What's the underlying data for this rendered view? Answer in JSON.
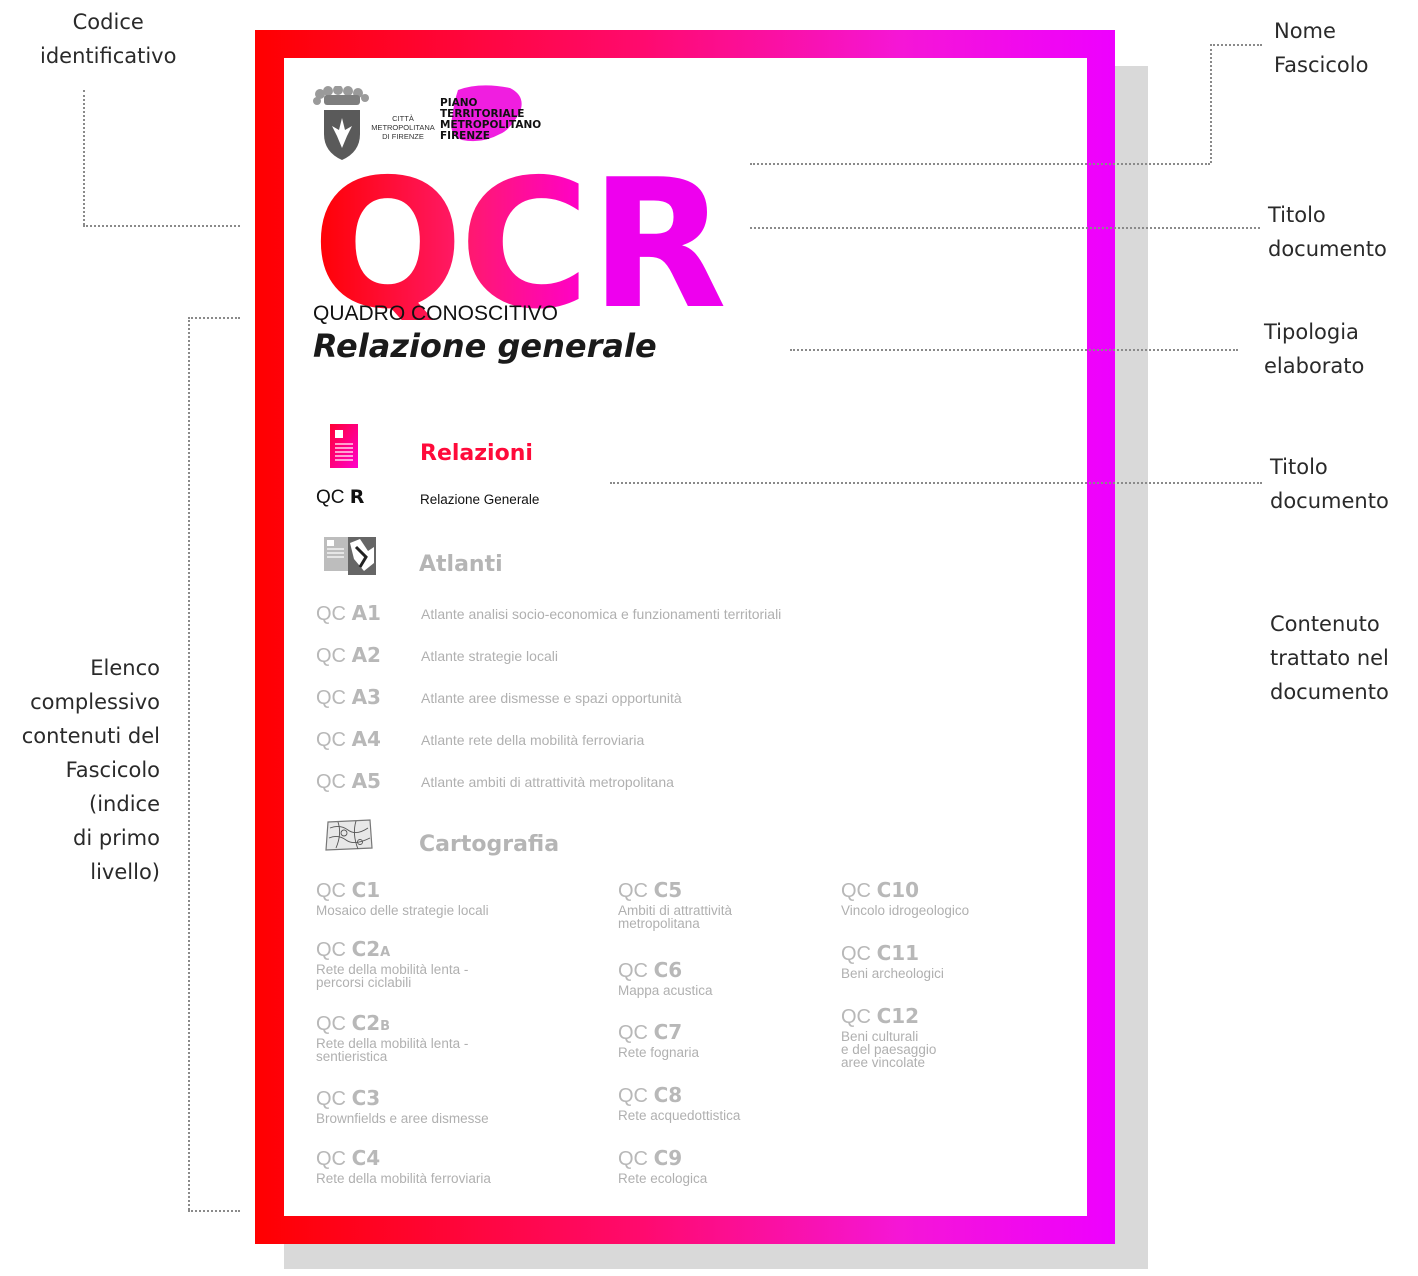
{
  "annotations": {
    "codice": "Codice\nidentificativo",
    "nome_fascicolo": "Nome\nFascicolo",
    "titolo_documento_1": "Titolo\ndocumento",
    "tipologia": "Tipologia\nelaborato",
    "titolo_documento_2": "Titolo\ndocumento",
    "contenuto": "Contenuto\ntrattato nel\ndocumento",
    "elenco": "Elenco\ncomplessivo\ncontenuti del\nFascicolo\n(indice\ndi primo\nlivello)"
  },
  "header": {
    "city_line1": "CITTÀ METROPOLITANA",
    "city_line2": "DI FIRENZE",
    "plan_line1": "PIANO",
    "plan_line2": "TERRITORIALE",
    "plan_line3": "METROPOLITANO",
    "plan_line4": "FIRENZE"
  },
  "title": {
    "code_qc": "QC",
    "code_r": "R",
    "subtitle": "QUADRO CONOSCITIVO",
    "doc_type": "Relazione generale"
  },
  "relazioni": {
    "heading": "Relazioni",
    "items": [
      {
        "code_prefix": "QC",
        "code": "R",
        "label": "Relazione Generale"
      }
    ]
  },
  "atlanti": {
    "heading": "Atlanti",
    "items": [
      {
        "code_prefix": "QC",
        "code": "A1",
        "label": "Atlante analisi socio-economica e funzionamenti territoriali"
      },
      {
        "code_prefix": "QC",
        "code": "A2",
        "label": "Atlante strategie locali"
      },
      {
        "code_prefix": "QC",
        "code": "A3",
        "label": "Atlante aree dismesse e spazi opportunità"
      },
      {
        "code_prefix": "QC",
        "code": "A4",
        "label": "Atlante rete della mobilità ferroviaria"
      },
      {
        "code_prefix": "QC",
        "code": "A5",
        "label": "Atlante ambiti di attrattività metropolitana"
      }
    ]
  },
  "cartografia": {
    "heading": "Cartografia",
    "items": [
      {
        "code_prefix": "QC",
        "code": "C1",
        "label": "Mosaico delle strategie locali"
      },
      {
        "code_prefix": "QC",
        "code": "C2",
        "suffix": "A",
        "label": "Rete della mobilità lenta -\npercorsi ciclabili"
      },
      {
        "code_prefix": "QC",
        "code": "C2",
        "suffix": "B",
        "label": "Rete della mobilità lenta -\nsentieristica"
      },
      {
        "code_prefix": "QC",
        "code": "C3",
        "label": "Brownfields e aree dismesse"
      },
      {
        "code_prefix": "QC",
        "code": "C4",
        "label": "Rete della mobilità ferroviaria"
      },
      {
        "code_prefix": "QC",
        "code": "C5",
        "label": "Ambiti di attrattività\nmetropolitana"
      },
      {
        "code_prefix": "QC",
        "code": "C6",
        "label": "Mappa acustica"
      },
      {
        "code_prefix": "QC",
        "code": "C7",
        "label": "Rete fognaria"
      },
      {
        "code_prefix": "QC",
        "code": "C8",
        "label": "Rete acquedottistica"
      },
      {
        "code_prefix": "QC",
        "code": "C9",
        "label": "Rete ecologica"
      },
      {
        "code_prefix": "QC",
        "code": "C10",
        "label": "Vincolo idrogeologico"
      },
      {
        "code_prefix": "QC",
        "code": "C11",
        "label": "Beni archeologici"
      },
      {
        "code_prefix": "QC",
        "code": "C12",
        "label": "Beni culturali\ne del paesaggio\naree vincolate"
      }
    ]
  },
  "colors": {
    "accent_red": "#ff0000",
    "accent_magenta": "#ee00ee",
    "gray_text": "#b5b5b5"
  }
}
